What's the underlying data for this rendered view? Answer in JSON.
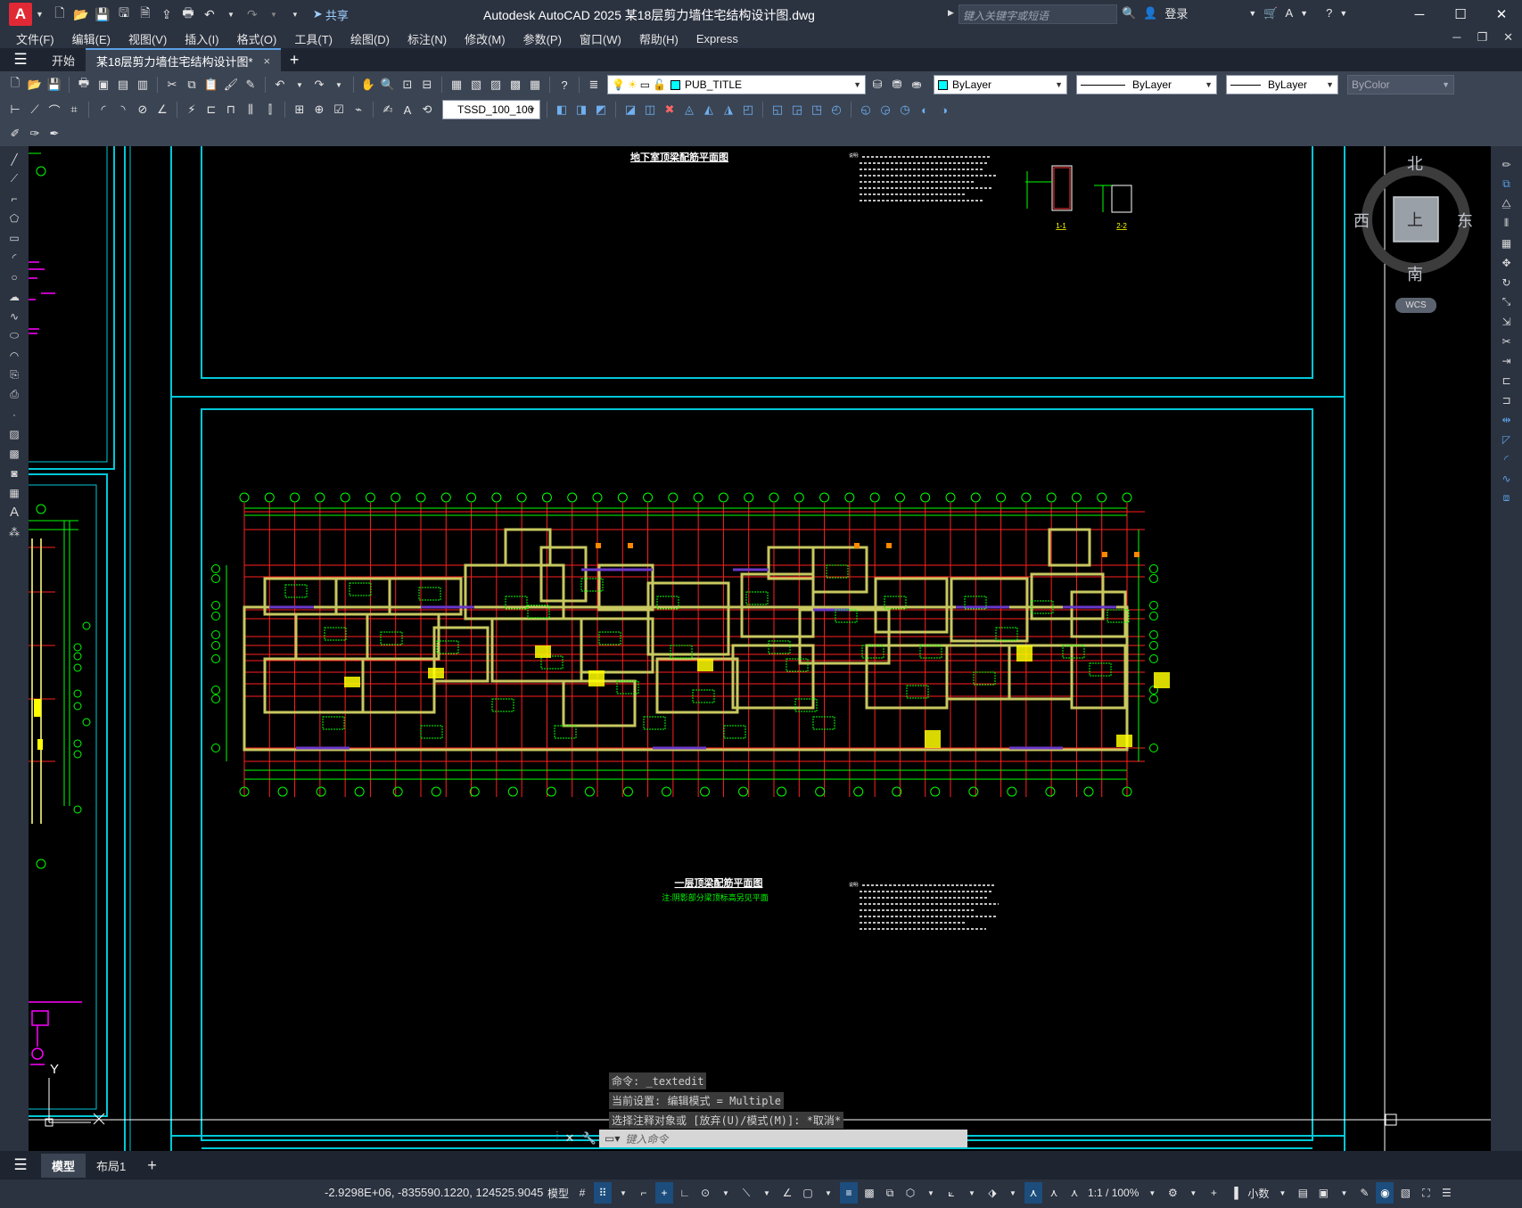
{
  "titlebar": {
    "logo": "A",
    "app_title": "Autodesk AutoCAD 2025    某18层剪力墙住宅结构设计图.dwg",
    "share_label": "共享",
    "search_placeholder": "键入关键字或短语",
    "login_label": "登录"
  },
  "menu": {
    "items": [
      "文件(F)",
      "编辑(E)",
      "视图(V)",
      "插入(I)",
      "格式(O)",
      "工具(T)",
      "绘图(D)",
      "标注(N)",
      "修改(M)",
      "参数(P)",
      "窗口(W)",
      "帮助(H)",
      "Express"
    ]
  },
  "tabs": {
    "start_label": "开始",
    "active_label": "某18层剪力墙住宅结构设计图*",
    "close_glyph": "×",
    "new_glyph": "+"
  },
  "toolbar": {
    "layer_name": "PUB_TITLE",
    "color": "ByLayer",
    "linetype": "ByLayer",
    "lineweight": "ByLayer",
    "plotstyle": "ByColor",
    "dimstyle": "TSSD_100_100"
  },
  "drawing": {
    "top_title": "地下室顶梁配筋平面图",
    "main_title": "一层顶梁配筋平面图",
    "main_subtitle": "注:阴影部分梁顶标高另见平面",
    "section_1": "1-1",
    "section_2": "2-2",
    "notes_heading": "说明:"
  },
  "viewcube": {
    "north": "北",
    "south": "南",
    "east": "东",
    "west": "西",
    "face": "上",
    "wcs": "WCS"
  },
  "ucs": {
    "y_label": "Y"
  },
  "command": {
    "history": [
      "命令: _textedit",
      "当前设置: 编辑模式 = Multiple",
      "选择注释对象或 [放弃(U)/模式(M)]: *取消*"
    ],
    "placeholder": "键入命令"
  },
  "layout_tabs": {
    "model": "模型",
    "layout1": "布局1",
    "add": "+"
  },
  "status": {
    "coords": "-2.9298E+06, -835590.1220, 124525.9045",
    "mode": "模型",
    "scale": "1:1 / 100%",
    "units": "小数"
  },
  "colors": {
    "frame": "#00c8d8",
    "grid": "#ff2020",
    "wall": "#c8c860",
    "text": "#00ff00",
    "annotation": "#ffff00",
    "magenta": "#ff00ff",
    "accent": "#5ba0e6"
  }
}
